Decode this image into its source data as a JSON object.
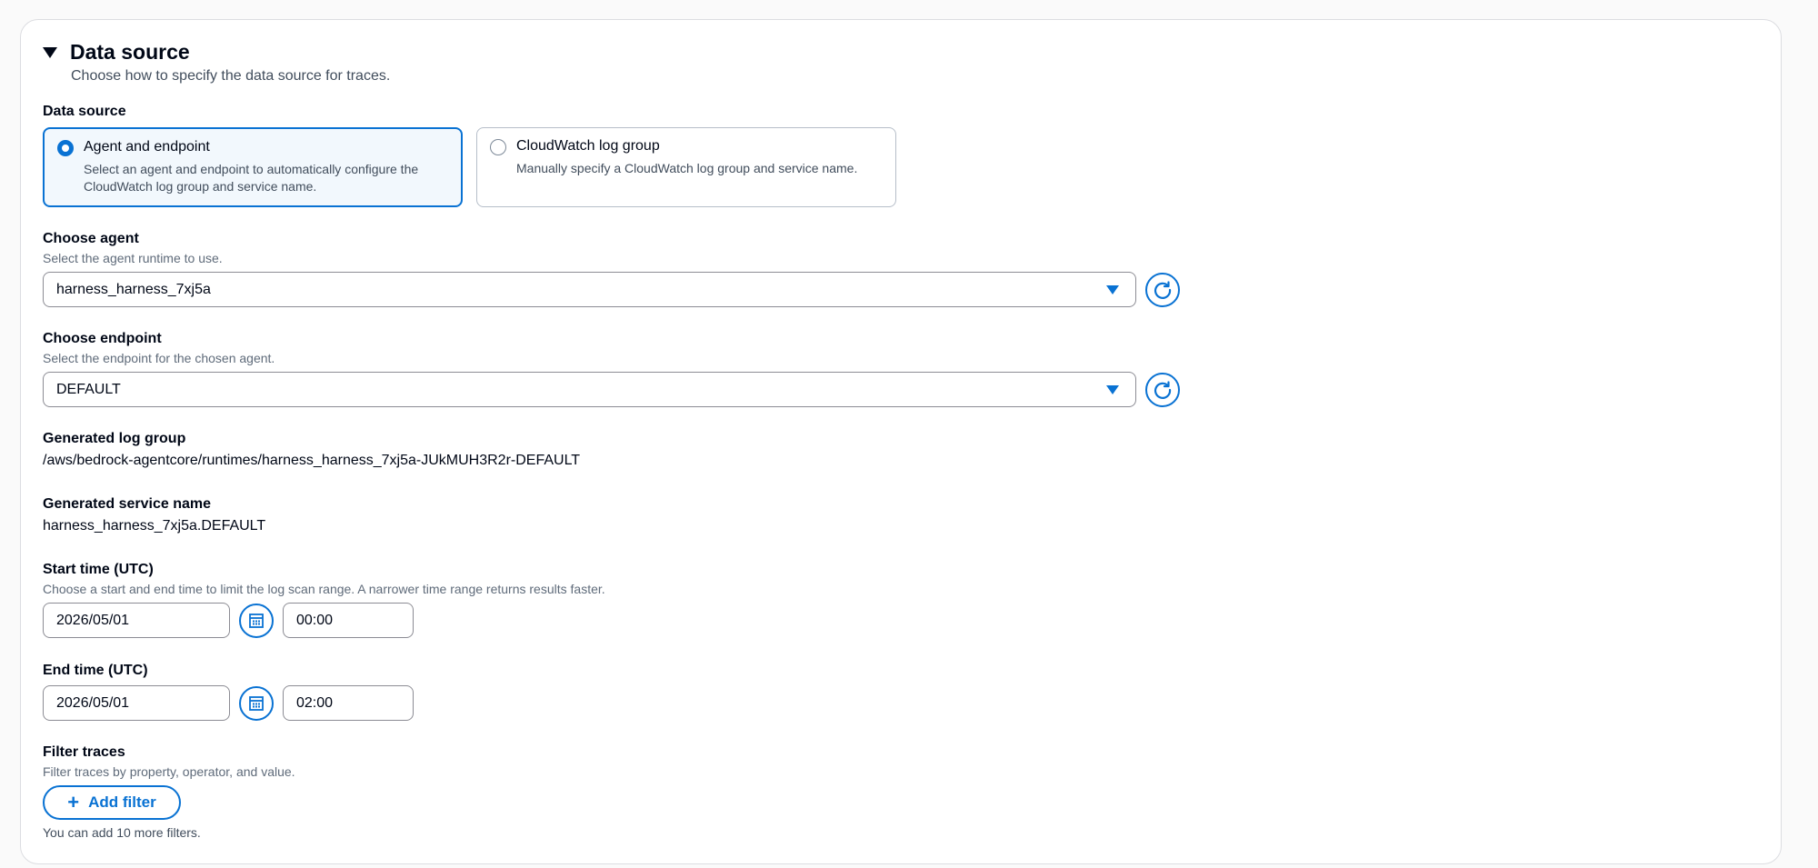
{
  "section": {
    "title": "Data source",
    "description": "Choose how to specify the data source for traces."
  },
  "data_source": {
    "label": "Data source",
    "options": [
      {
        "title": "Agent and endpoint",
        "description": "Select an agent and endpoint to automatically configure the CloudWatch log group and service name.",
        "selected": true
      },
      {
        "title": "CloudWatch log group",
        "description": "Manually specify a CloudWatch log group and service name.",
        "selected": false
      }
    ]
  },
  "agent": {
    "label": "Choose agent",
    "description": "Select the agent runtime to use.",
    "value": "harness_harness_7xj5a"
  },
  "endpoint": {
    "label": "Choose endpoint",
    "description": "Select the endpoint for the chosen agent.",
    "value": "DEFAULT"
  },
  "log_group": {
    "label": "Generated log group",
    "value": "/aws/bedrock-agentcore/runtimes/harness_harness_7xj5a-JUkMUH3R2r-DEFAULT"
  },
  "service_name": {
    "label": "Generated service name",
    "value": "harness_harness_7xj5a.DEFAULT"
  },
  "start_time": {
    "label": "Start time (UTC)",
    "description": "Choose a start and end time to limit the log scan range. A narrower time range returns results faster.",
    "date": "2026/05/01",
    "time": "00:00"
  },
  "end_time": {
    "label": "End time (UTC)",
    "date": "2026/05/01",
    "time": "02:00"
  },
  "filter": {
    "label": "Filter traces",
    "description": "Filter traces by property, operator, and value.",
    "add_label": "Add filter",
    "hint": "You can add 10 more filters."
  },
  "icons": {
    "expand": "caret-down-icon",
    "refresh": "refresh-icon",
    "calendar": "calendar-icon",
    "dropdown": "dropdown-arrow-icon",
    "add": "plus-icon"
  },
  "colors": {
    "accent": "#0972d3",
    "border": "#8c8c94",
    "selected_bg": "#f2f8fd"
  }
}
